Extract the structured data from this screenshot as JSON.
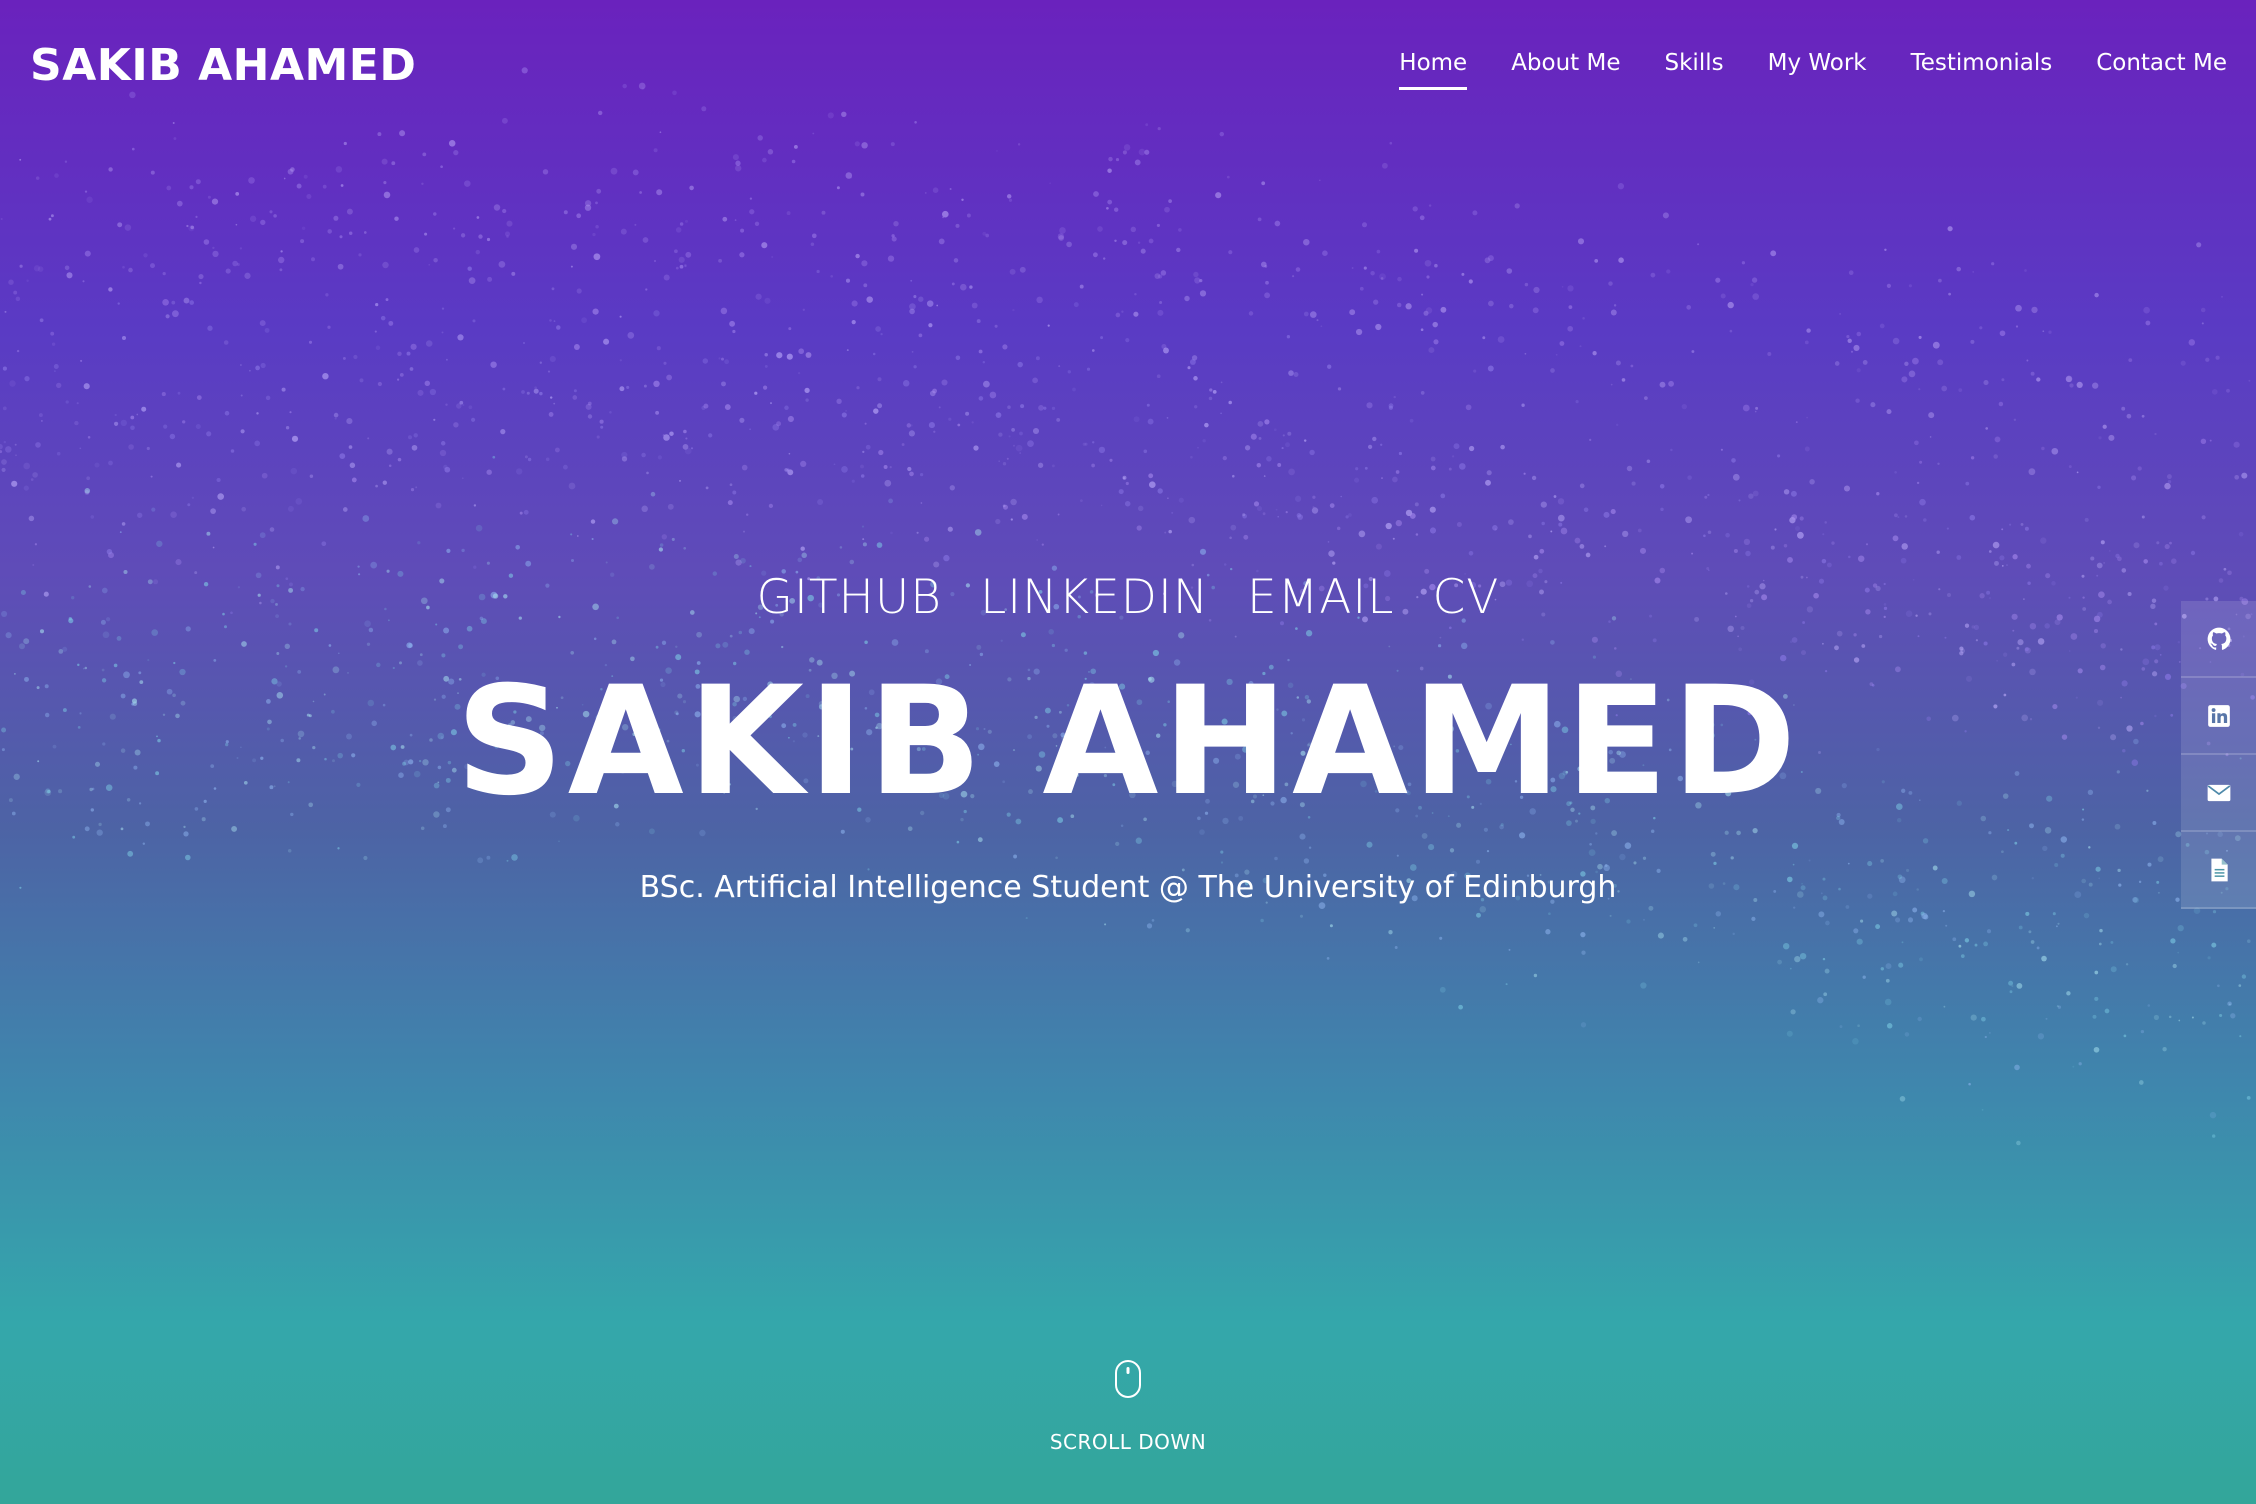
{
  "brand": "SAKIB AHAMED",
  "nav": {
    "items": [
      {
        "label": "Home",
        "active": true
      },
      {
        "label": "About Me"
      },
      {
        "label": "Skills"
      },
      {
        "label": "My Work"
      },
      {
        "label": "Testimonials"
      },
      {
        "label": "Contact Me"
      }
    ]
  },
  "hero": {
    "links": [
      "GITHUB",
      "LINKEDIN",
      "EMAIL",
      "CV"
    ],
    "name": "SAKIB AHAMED",
    "subtitle": "BSc. Artificial Intelligence Student @ The University of Edinburgh",
    "scroll_label": "SCROLL DOWN"
  },
  "side_bar": {
    "icons": [
      "github-icon",
      "linkedin-icon",
      "envelope-icon",
      "document-icon"
    ]
  },
  "colors": {
    "gradient_top": "#6a22bd",
    "gradient_bottom": "#33a69a",
    "text": "#ffffff"
  }
}
